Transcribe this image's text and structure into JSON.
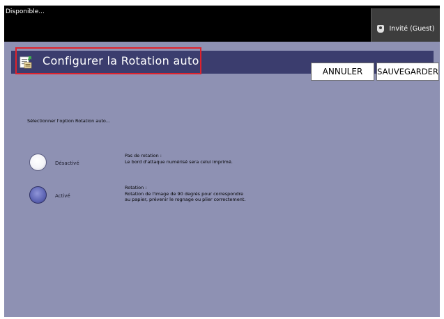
{
  "status": {
    "text": "Disponible..."
  },
  "user": {
    "label": "Invité (Guest)",
    "icon": "user-icon"
  },
  "header": {
    "title": "Configurer la Rotation auto",
    "icon": "settings-document-icon",
    "cancel_label": "ANNULER",
    "save_label": "SAUVEGARDER"
  },
  "content": {
    "prompt": "Sélectionner l'option Rotation auto...",
    "options": [
      {
        "label": "Désactivé",
        "selected": false,
        "desc_title": "Pas de rotation :",
        "desc_lines": [
          "Le bord d'attaque numérisé sera celui imprimé."
        ]
      },
      {
        "label": "Activé",
        "selected": true,
        "desc_title": "Rotation :",
        "desc_lines": [
          "Rotation de l'image de 90 degrés pour correspondre",
          "au papier, prévenir le rognage ou plier correctement."
        ]
      }
    ]
  },
  "colors": {
    "background": "#8e91b3",
    "title_bar": "#3b3d6e",
    "highlight": "#e0222c",
    "status_bar": "#000000"
  }
}
